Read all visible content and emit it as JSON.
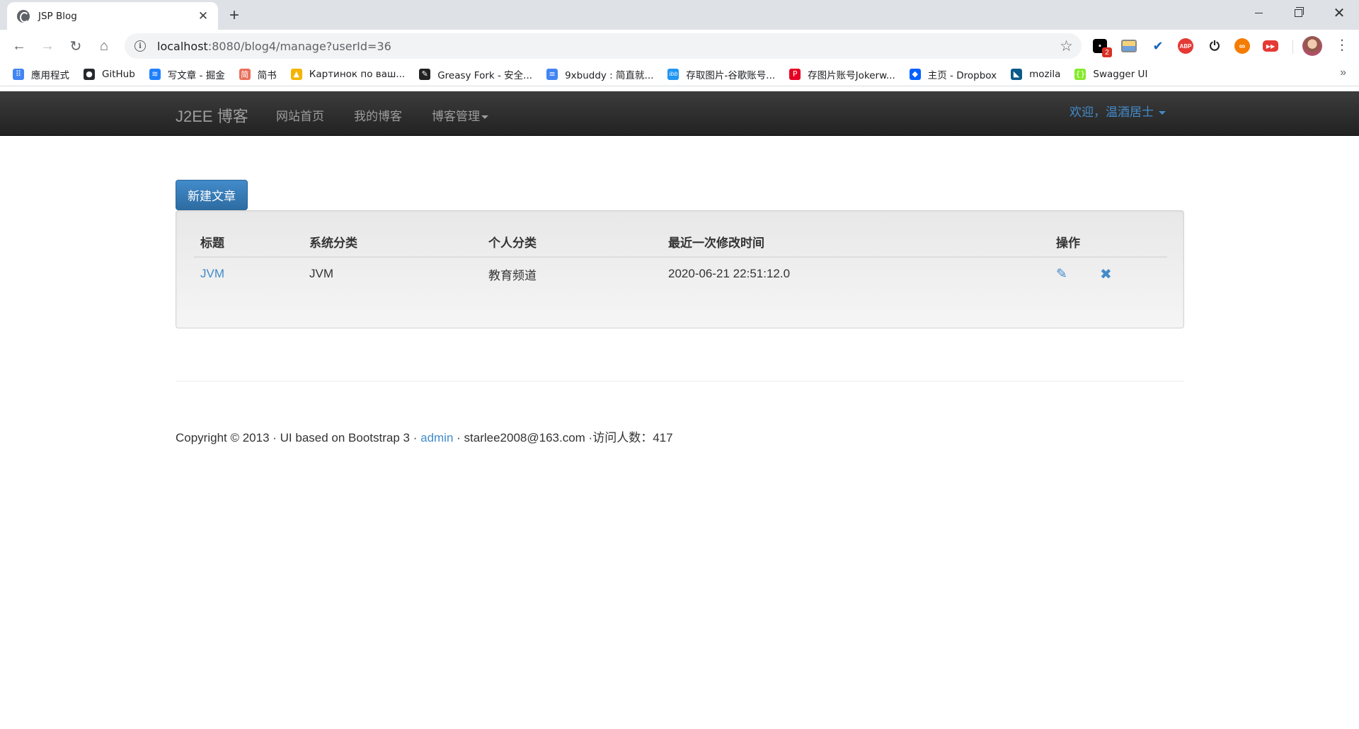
{
  "browser": {
    "tab_title": "JSP Blog",
    "url_host": "localhost",
    "url_rest": ":8080/blog4/manage?userId=36",
    "extension_badge": "2",
    "extension_abp": "ABP"
  },
  "bookmarks": [
    {
      "label": "應用程式",
      "icon": "apps-grid-icon",
      "color": "#4285f4"
    },
    {
      "label": "GitHub",
      "icon": "github-icon",
      "color": "#24292e"
    },
    {
      "label": "写文章 - 掘金",
      "icon": "juejin-icon",
      "color": "#1e80ff"
    },
    {
      "label": "简书",
      "icon": "jianshu-icon",
      "color": "#ea6f5a"
    },
    {
      "label": "Картинок по ваш...",
      "icon": "image-icon",
      "color": "#f4b400"
    },
    {
      "label": "Greasy Fork - 安全...",
      "icon": "greasyfork-icon",
      "color": "#222222"
    },
    {
      "label": "9xbuddy : 简直就...",
      "icon": "doc-icon",
      "color": "#4285f4"
    },
    {
      "label": "存取图片-谷歌账号...",
      "icon": "ibb-icon",
      "color": "#2196f3"
    },
    {
      "label": "存图片账号Jokerw...",
      "icon": "pinterest-icon",
      "color": "#e60023"
    },
    {
      "label": "主页 - Dropbox",
      "icon": "dropbox-icon",
      "color": "#0061ff"
    },
    {
      "label": "mozila",
      "icon": "mozilla-icon",
      "color": "#0a5a8a"
    },
    {
      "label": "Swagger UI",
      "icon": "swagger-icon",
      "color": "#85ea2d"
    }
  ],
  "navbar": {
    "brand": "J2EE 博客",
    "home": "网站首页",
    "my_blog": "我的博客",
    "manage": "博客管理",
    "welcome": "欢迎，温酒居士"
  },
  "main": {
    "new_article": "新建文章",
    "table": {
      "headers": [
        "标题",
        "系统分类",
        "个人分类",
        "最近一次修改时间",
        "操作"
      ],
      "rows": [
        {
          "title": "JVM",
          "system_category": "JVM",
          "personal_category": "教育频道",
          "modified": "2020-06-21 22:51:12.0"
        }
      ]
    }
  },
  "footer": {
    "prefix": "Copyright © 2013 · UI based on Bootstrap 3 · ",
    "admin": "admin",
    "suffix": " · starlee2008@163.com ·访问人数：417"
  }
}
